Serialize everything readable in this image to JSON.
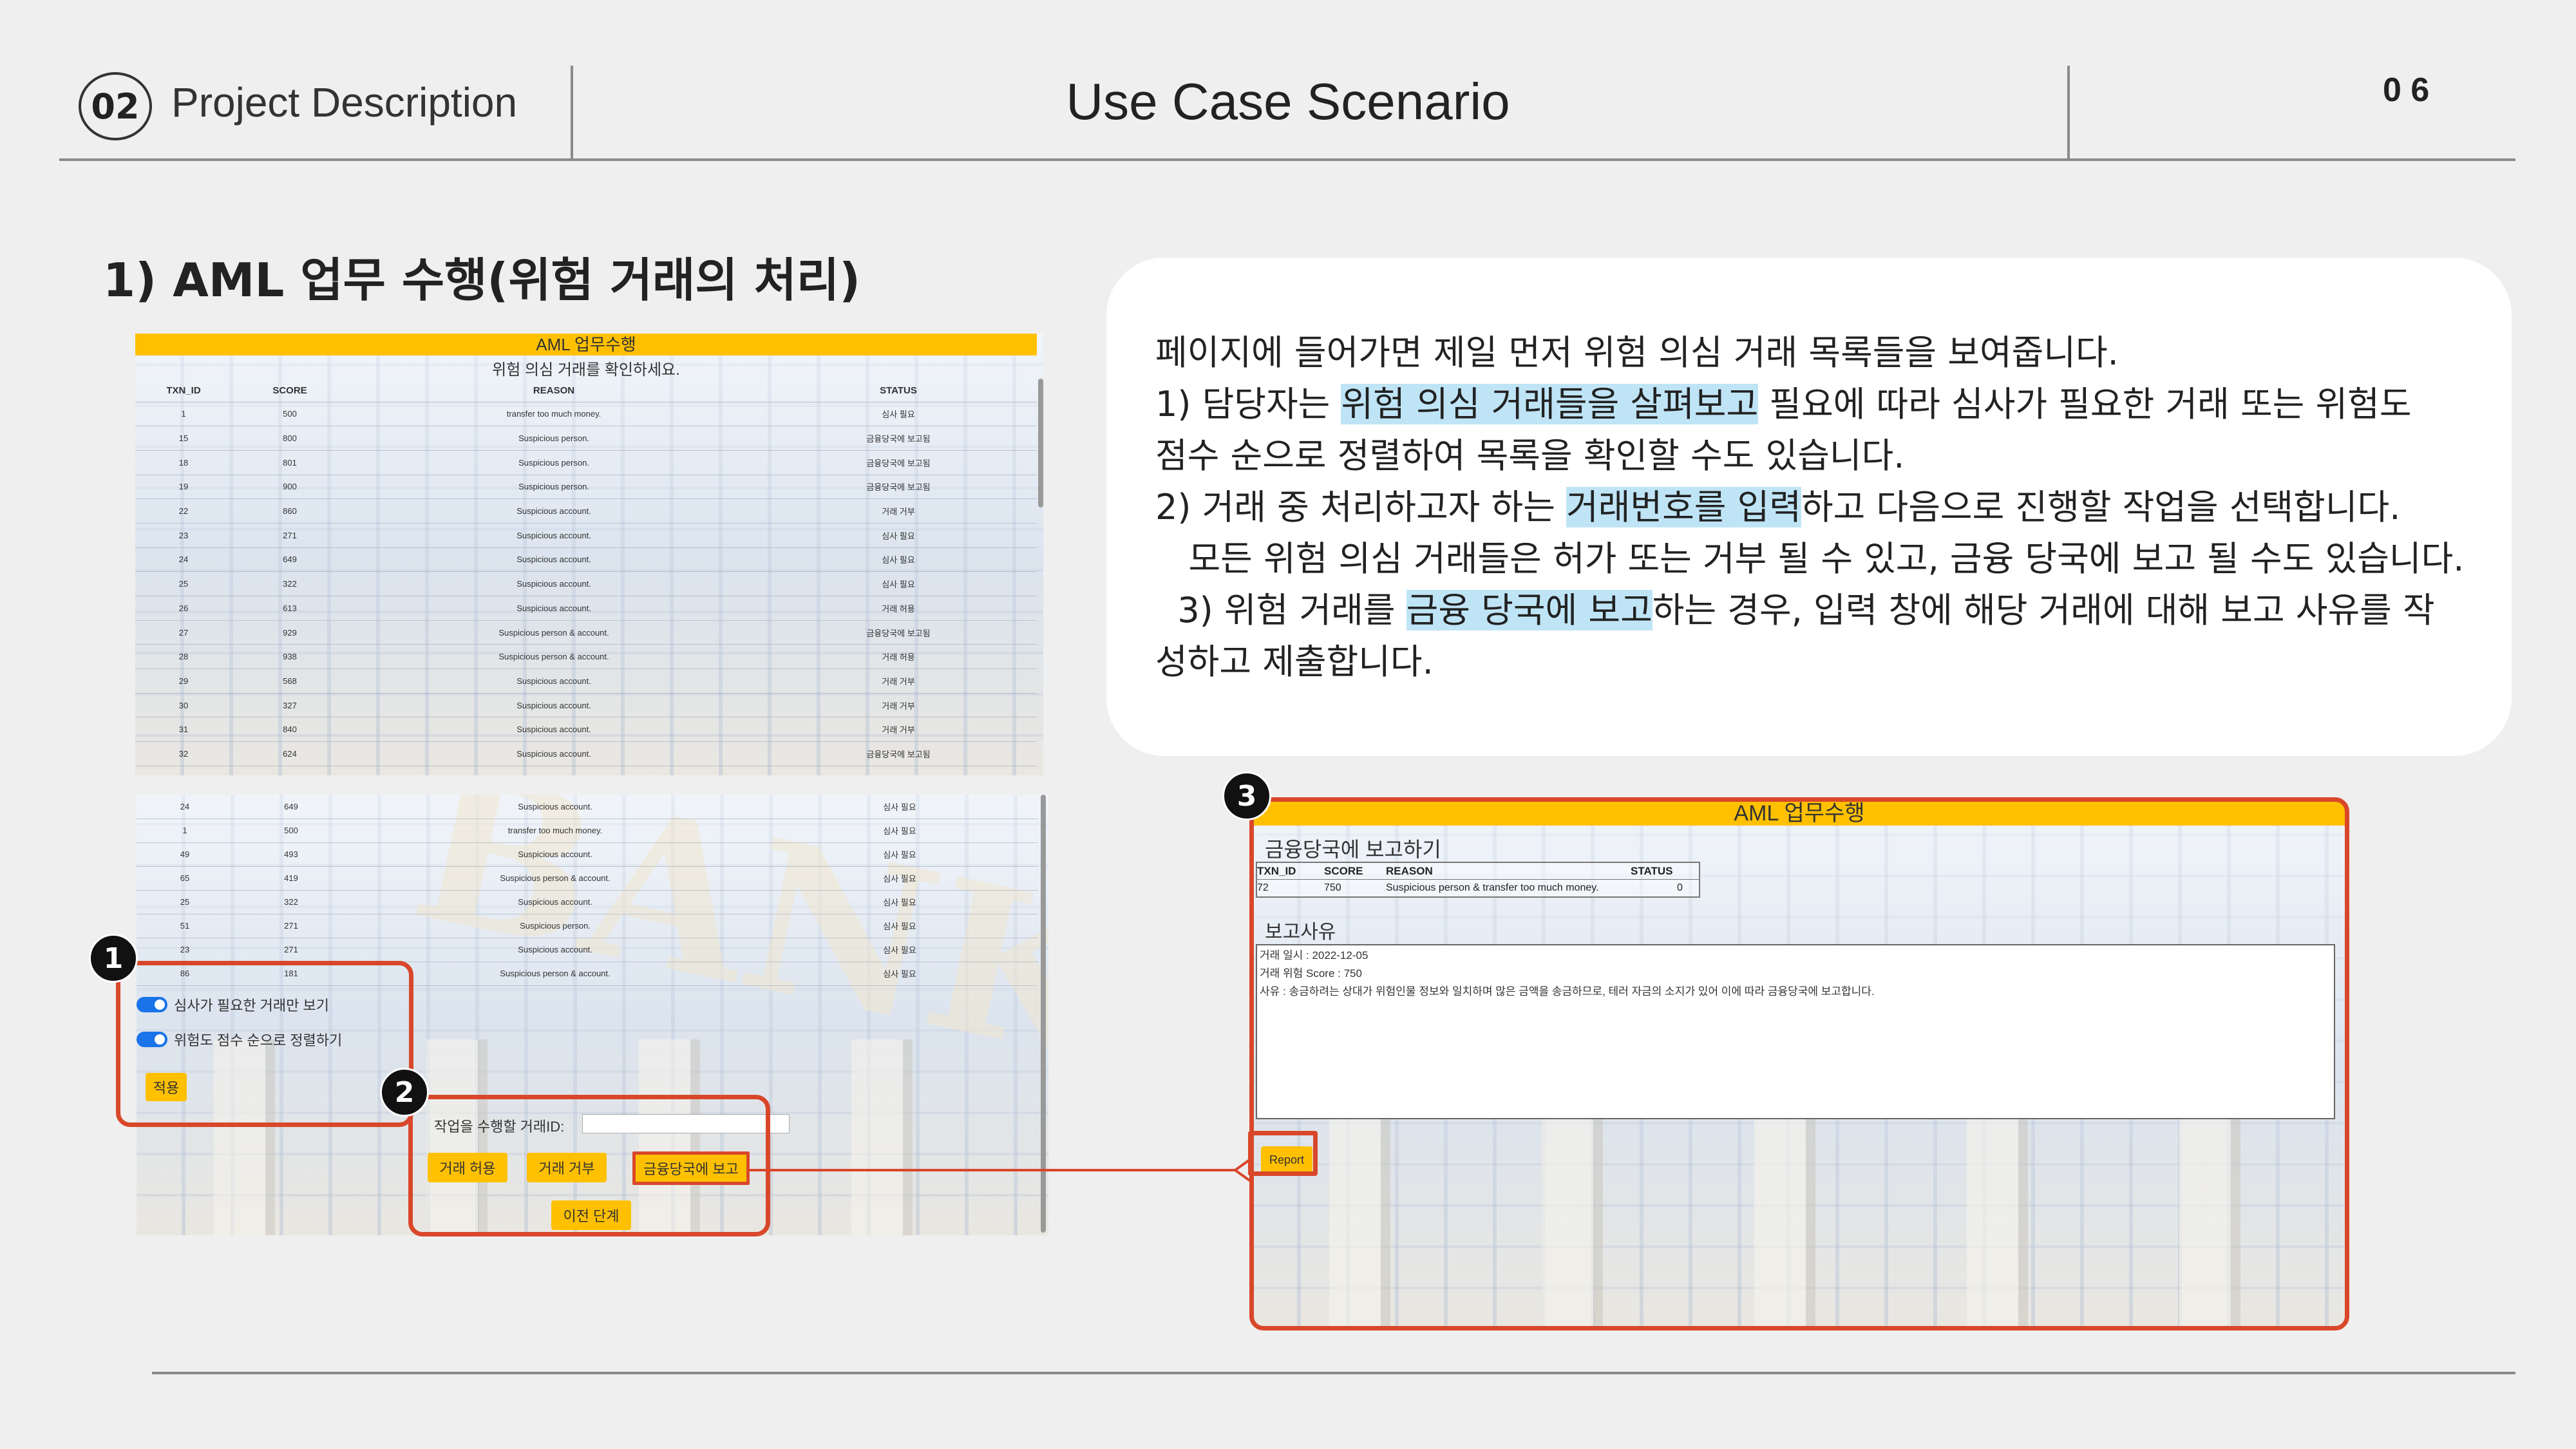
{
  "header": {
    "section_number": "02",
    "section_title": "Project Description",
    "page_title": "Use Case Scenario",
    "page_number": "0 6"
  },
  "heading": "1) AML 업무 수행(위험 거래의 처리)",
  "description": {
    "line1": "페이지에 들어가면 제일 먼저 위험 의심 거래 목록들을 보여줍니다.",
    "l2_a": " 1) 담당자는 ",
    "l2_hl": "위험 의심 거래들을 살펴보고",
    "l2_b": " 필요에 따라 심사가 필요한 거래 또는 위험도",
    "line3": "점수 순으로 정렬하여 목록을 확인할 수도 있습니다.",
    "l4_a": " 2) 거래 중 처리하고자 하는 ",
    "l4_hl": "거래번호를 입력",
    "l4_b": "하고 다음으로 진행할 작업을 선택합니다.",
    "line5": "   모든 위험 의심 거래들은 허가 또는 거부 될 수 있고, 금융 당국에 보고 될 수도 있습니다.",
    "l6_a": "  3) 위험 거래를 ",
    "l6_hl": "금융 당국에 보고",
    "l6_b": "하는 경우, 입력 창에 해당 거래에 대해 보고 사유를 작",
    "line7": "성하고 제출합니다."
  },
  "screen1": {
    "title": "AML 업무수행",
    "subtitle": "위험 의심 거래를 확인하세요.",
    "columns": [
      "TXN_ID",
      "SCORE",
      "REASON",
      "STATUS"
    ],
    "rows": [
      [
        "1",
        "500",
        "transfer too much money.",
        "심사 필요"
      ],
      [
        "15",
        "800",
        "Suspicious person.",
        "금융당국에 보고됨"
      ],
      [
        "18",
        "801",
        "Suspicious person.",
        "금융당국에 보고됨"
      ],
      [
        "19",
        "900",
        "Suspicious person.",
        "금융당국에 보고됨"
      ],
      [
        "22",
        "860",
        "Suspicious account.",
        "거래 거부"
      ],
      [
        "23",
        "271",
        "Suspicious account.",
        "심사 필요"
      ],
      [
        "24",
        "649",
        "Suspicious account.",
        "심사 필요"
      ],
      [
        "25",
        "322",
        "Suspicious account.",
        "심사 필요"
      ],
      [
        "26",
        "613",
        "Suspicious account.",
        "거래 허용"
      ],
      [
        "27",
        "929",
        "Suspicious person & account.",
        "금융당국에 보고됨"
      ],
      [
        "28",
        "938",
        "Suspicious person & account.",
        "거래 허용"
      ],
      [
        "29",
        "568",
        "Suspicious account.",
        "거래 거부"
      ],
      [
        "30",
        "327",
        "Suspicious account.",
        "거래 거부"
      ],
      [
        "31",
        "840",
        "Suspicious account.",
        "거래 거부"
      ],
      [
        "32",
        "624",
        "Suspicious account.",
        "금융당국에 보고됨"
      ]
    ]
  },
  "screen2": {
    "rows": [
      [
        "24",
        "649",
        "Suspicious account.",
        "심사 필요"
      ],
      [
        "1",
        "500",
        "transfer too much money.",
        "심사 필요"
      ],
      [
        "49",
        "493",
        "Suspicious account.",
        "심사 필요"
      ],
      [
        "65",
        "419",
        "Suspicious person & account.",
        "심사 필요"
      ],
      [
        "25",
        "322",
        "Suspicious account.",
        "심사 필요"
      ],
      [
        "51",
        "271",
        "Suspicious person.",
        "심사 필요"
      ],
      [
        "23",
        "271",
        "Suspicious account.",
        "심사 필요"
      ],
      [
        "86",
        "181",
        "Suspicious person & account.",
        "심사 필요"
      ]
    ],
    "toggle1_label": "심사가 필요한 거래만 보기",
    "toggle2_label": "위험도 점수 순으로 정렬하기",
    "apply_label": "적용",
    "txn_id_label": "작업을 수행할 거래ID:",
    "txn_id_value": "",
    "allow_label": "거래 허용",
    "deny_label": "거래 거부",
    "report_label": "금융당국에 보고",
    "back_label": "이전 단계"
  },
  "screen3": {
    "title": "AML 업무수행",
    "subtitle": "금융당국에 보고하기",
    "columns": [
      "TXN_ID",
      "SCORE",
      "REASON",
      "STATUS"
    ],
    "row": [
      "72",
      "750",
      "Suspicious person & transfer too much money.",
      "0"
    ],
    "reason_label": "보고사유",
    "reason_line1": "거래 일시 : 2022-12-05",
    "reason_line2": "거래 위험 Score : 750",
    "reason_line3": "사유 : 송금하려는 상대가 위험인물 정보와 일치하며 많은 금액을 송금하므로, 테러 자금의 소지가 있어 이에 따라 금융당국에 보고합니다.",
    "submit_label": "Report"
  },
  "badges": [
    "1",
    "2",
    "3"
  ],
  "colors": {
    "accent_yellow": "#ffc000",
    "callout_red": "#d9472a",
    "highlight": "#bfe4f6"
  }
}
